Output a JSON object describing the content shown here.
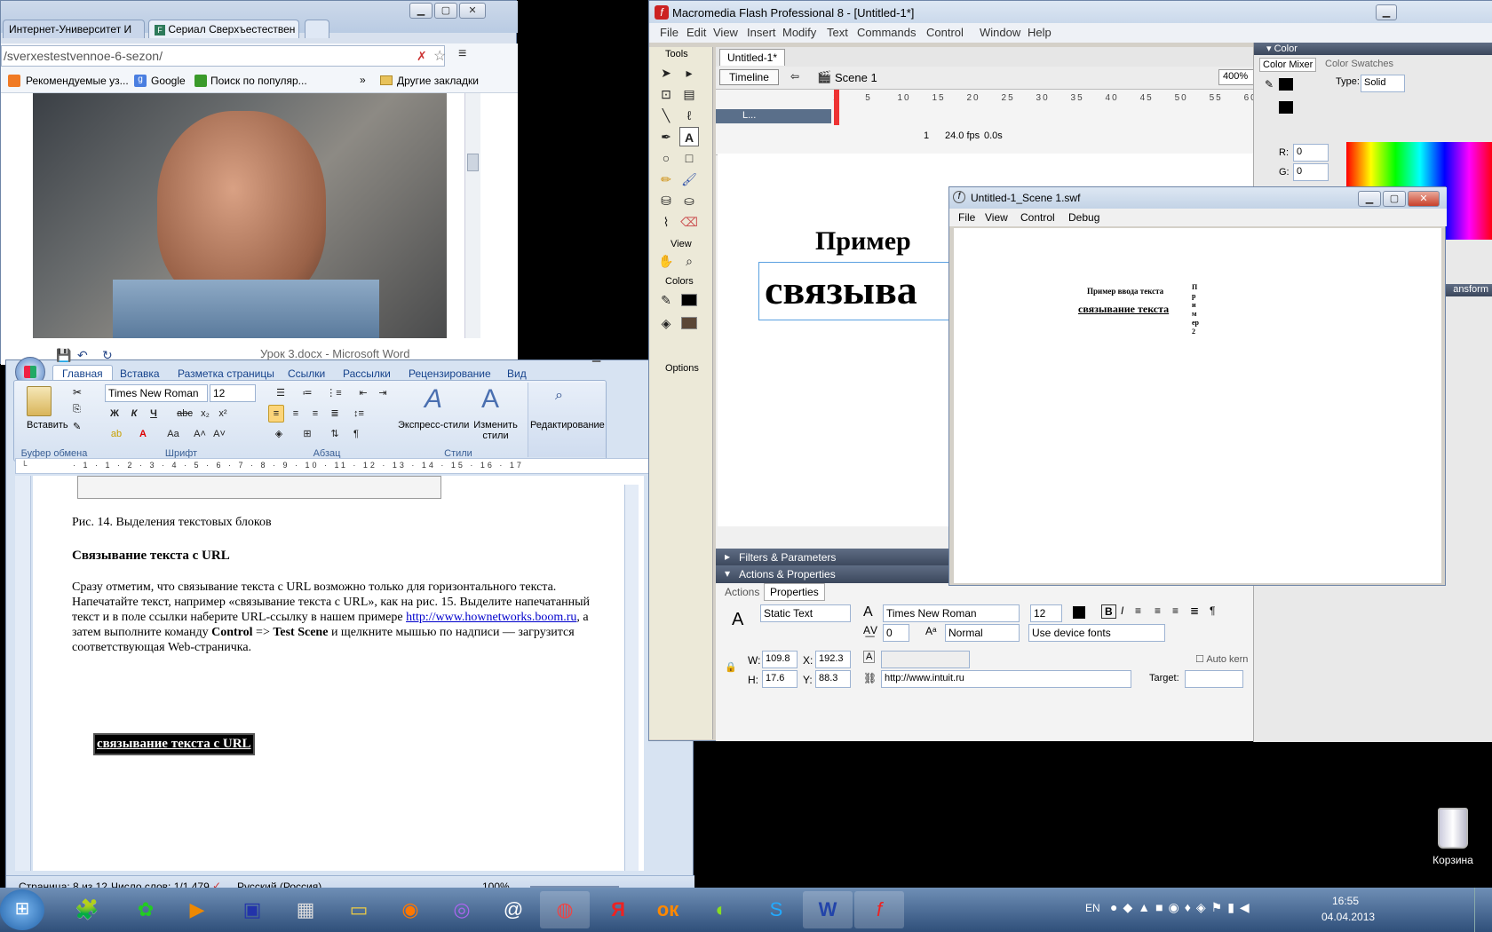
{
  "chrome": {
    "tabs": [
      {
        "label": "Интернет-Университет И"
      },
      {
        "label": "Сериал Сверхъестествен"
      }
    ],
    "address": "/sverxestestvennoe-6-sezon/",
    "bookmarks": [
      "Рекомендуемые уз...",
      "Google",
      "Поиск по популяр..."
    ],
    "other_bookmarks": "Другие закладки",
    "more": "»"
  },
  "word": {
    "title": "Урок 3.docx - Microsoft Word",
    "tabs": [
      "Главная",
      "Вставка",
      "Разметка страницы",
      "Ссылки",
      "Рассылки",
      "Рецензирование",
      "Вид"
    ],
    "font_name": "Times New Roman",
    "font_size": "12",
    "groups": [
      "Буфер обмена",
      "Шрифт",
      "Абзац",
      "Стили"
    ],
    "paste_label": "Вставить",
    "express_styles": "Экспресс-стили",
    "change_styles": "Изменить стили",
    "editing": "Редактирование",
    "doc": {
      "caption": "Рис. 14. Выделения текстовых блоков",
      "heading": "Связывание текста с URL",
      "para_1": "Сразу отметим, что связывание текста с URL возможно только для горизонтального текста. Напечатайте текст, например «связывание текста с URL», как на рис. 15. Выделите напечатанный текст и в поле ссылки наберите URL-ссылку в нашем примере ",
      "link": "http://www.hownetworks.boom.ru",
      "para_2": ", а затем выполните команду ",
      "cmd_1": "Control",
      "arrow": " => ",
      "cmd_2": "Test Scene",
      "para_3": " и щелкните мышью по надписи — загрузится соответствующая Web-страничка.",
      "sample": "связывание текста с URL"
    },
    "status": {
      "page": "Страница: 8 из 12",
      "words": "Число слов: 1/1 479",
      "lang": "Русский (Россия)",
      "zoom": "100%"
    }
  },
  "flash": {
    "title": "Macromedia Flash Professional 8 - [Untitled-1*]",
    "menu": [
      "File",
      "Edit",
      "View",
      "Insert",
      "Modify",
      "Text",
      "Commands",
      "Control",
      "Window",
      "Help"
    ],
    "doc_tab": "Untitled-1*",
    "timeline_btn": "Timeline",
    "scene": "Scene 1",
    "zoom": "400%",
    "layer": "L...",
    "frame": "1",
    "fps": "24.0 fps",
    "time": "0.0s",
    "tools_label": "Tools",
    "view_label": "View",
    "colors_label": "Colors",
    "options_label": "Options",
    "stage_title": "Пример",
    "stage_text": "связыва",
    "filters_label": "Filters & Parameters",
    "actions_label": "Actions & Properties",
    "props_tabs": [
      "Actions",
      "Properties"
    ],
    "text_type": "Static Text",
    "font": "Times New Roman",
    "size": "12",
    "spacing": "0",
    "normal": "Normal",
    "render": "Use device fonts",
    "w": "109.8",
    "x": "192.3",
    "h": "17.6",
    "y": "88.3",
    "url": "http://www.intuit.ru",
    "target_label": "Target:",
    "autokern": "Auto kern",
    "color_panel": {
      "title": "Color",
      "mixer": "Color Mixer",
      "swatches": "Color Swatches",
      "type_label": "Type:",
      "type": "Solid",
      "r": "0",
      "g": "0",
      "hex": "#000000",
      "transform": "ansform"
    }
  },
  "swf": {
    "title": "Untitled-1_Scene 1.swf",
    "menu": [
      "File",
      "View",
      "Control",
      "Debug"
    ],
    "heading": "Пример ввода текста",
    "text": "связывание текста",
    "vertical": "Пример 2"
  },
  "taskbar": {
    "lang": "EN",
    "time": "16:55",
    "date": "04.04.2013",
    "recycle": "Корзина"
  }
}
